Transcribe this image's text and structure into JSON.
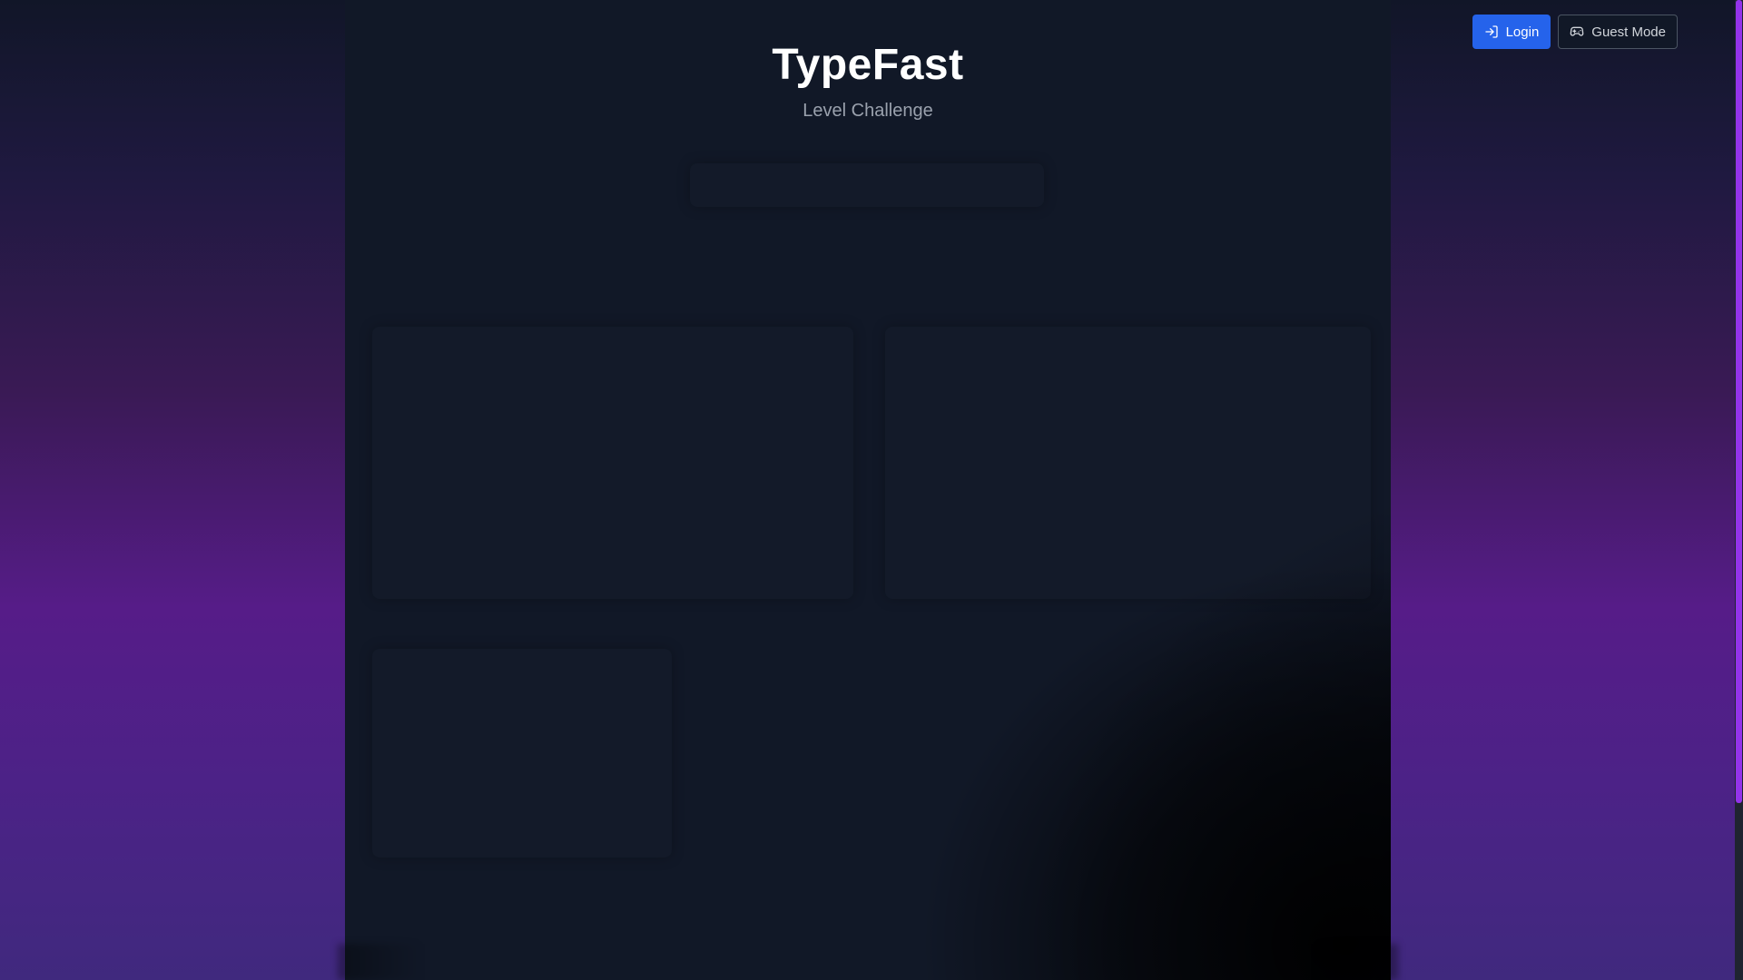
{
  "header": {
    "title": "TypeFast",
    "subtitle": "Level Challenge"
  },
  "top_actions": {
    "login_label": "Login",
    "login_icon": "login-arrow-icon",
    "guest_label": "Guest Mode",
    "guest_icon": "gamepad-icon"
  },
  "colors": {
    "login_button": "#2563eb",
    "panel_background": "#111827",
    "scrollbar_thumb": "#9333ea",
    "page_gradient_mid": "#561c88"
  }
}
